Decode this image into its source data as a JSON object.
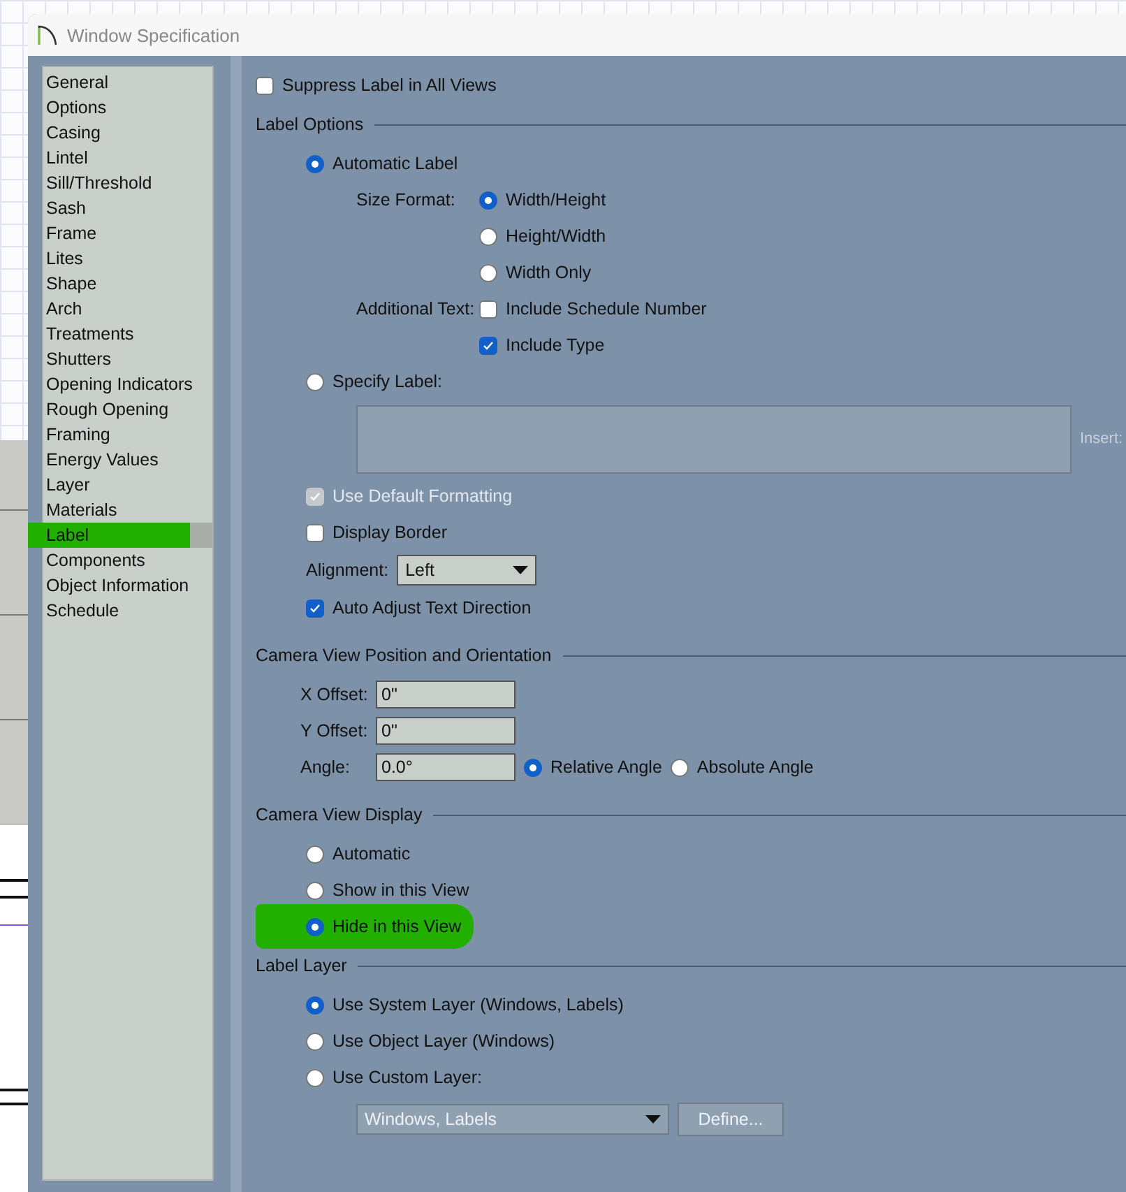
{
  "window": {
    "title": "Window Specification"
  },
  "sidebar": {
    "items": [
      {
        "label": "General",
        "selected": false,
        "highlighted": false
      },
      {
        "label": "Options",
        "selected": false,
        "highlighted": false
      },
      {
        "label": "Casing",
        "selected": false,
        "highlighted": false
      },
      {
        "label": "Lintel",
        "selected": false,
        "highlighted": false
      },
      {
        "label": "Sill/Threshold",
        "selected": false,
        "highlighted": false
      },
      {
        "label": "Sash",
        "selected": false,
        "highlighted": false
      },
      {
        "label": "Frame",
        "selected": false,
        "highlighted": false
      },
      {
        "label": "Lites",
        "selected": false,
        "highlighted": false
      },
      {
        "label": "Shape",
        "selected": false,
        "highlighted": false
      },
      {
        "label": "Arch",
        "selected": false,
        "highlighted": false
      },
      {
        "label": "Treatments",
        "selected": false,
        "highlighted": false
      },
      {
        "label": "Shutters",
        "selected": false,
        "highlighted": false
      },
      {
        "label": "Opening Indicators",
        "selected": false,
        "highlighted": false
      },
      {
        "label": "Rough Opening",
        "selected": false,
        "highlighted": false
      },
      {
        "label": "Framing",
        "selected": false,
        "highlighted": false
      },
      {
        "label": "Energy Values",
        "selected": false,
        "highlighted": false
      },
      {
        "label": "Layer",
        "selected": false,
        "highlighted": false
      },
      {
        "label": "Materials",
        "selected": false,
        "highlighted": false
      },
      {
        "label": "Label",
        "selected": true,
        "highlighted": true
      },
      {
        "label": "Components",
        "selected": false,
        "highlighted": false
      },
      {
        "label": "Object Information",
        "selected": false,
        "highlighted": false
      },
      {
        "label": "Schedule",
        "selected": false,
        "highlighted": false
      }
    ]
  },
  "suppress": {
    "label": "Suppress Label in All Views",
    "checked": false
  },
  "label_options": {
    "title": "Label Options",
    "automatic": {
      "label": "Automatic Label",
      "selected": true
    },
    "size_format": {
      "label": "Size Format:",
      "options": [
        {
          "label": "Width/Height",
          "selected": true
        },
        {
          "label": "Height/Width",
          "selected": false
        },
        {
          "label": "Width Only",
          "selected": false
        }
      ]
    },
    "additional_text": {
      "label": "Additional Text:",
      "options": [
        {
          "label": "Include Schedule Number",
          "checked": false
        },
        {
          "label": "Include Type",
          "checked": true
        }
      ]
    },
    "specify": {
      "label": "Specify Label:",
      "selected": false
    },
    "insert_label": "Insert:",
    "use_default_formatting": {
      "label": "Use Default Formatting",
      "checked": true,
      "disabled": true
    },
    "display_border": {
      "label": "Display Border",
      "checked": false
    },
    "alignment": {
      "label": "Alignment:",
      "value": "Left"
    },
    "auto_adjust": {
      "label": "Auto Adjust Text Direction",
      "checked": true
    }
  },
  "camera_position": {
    "title": "Camera View Position and Orientation",
    "fields": [
      {
        "label": "X Offset:",
        "value": "0\""
      },
      {
        "label": "Y Offset:",
        "value": "0\""
      },
      {
        "label": "Angle:",
        "value": "0.0°"
      }
    ],
    "angle_modes": [
      {
        "label": "Relative Angle",
        "selected": true
      },
      {
        "label": "Absolute Angle",
        "selected": false
      }
    ]
  },
  "camera_display": {
    "title": "Camera View Display",
    "options": [
      {
        "label": "Automatic",
        "selected": false,
        "highlighted": false
      },
      {
        "label": "Show in this View",
        "selected": false,
        "highlighted": false
      },
      {
        "label": "Hide in this View",
        "selected": true,
        "highlighted": true
      }
    ]
  },
  "label_layer": {
    "title": "Label Layer",
    "options": [
      {
        "label": "Use System Layer (Windows, Labels)",
        "selected": true
      },
      {
        "label": "Use Object Layer (Windows)",
        "selected": false
      },
      {
        "label": "Use Custom Layer:",
        "selected": false
      }
    ],
    "layer_select": {
      "value": "Windows, Labels",
      "disabled": true
    },
    "define_button": {
      "label": "Define...",
      "disabled": true
    }
  }
}
